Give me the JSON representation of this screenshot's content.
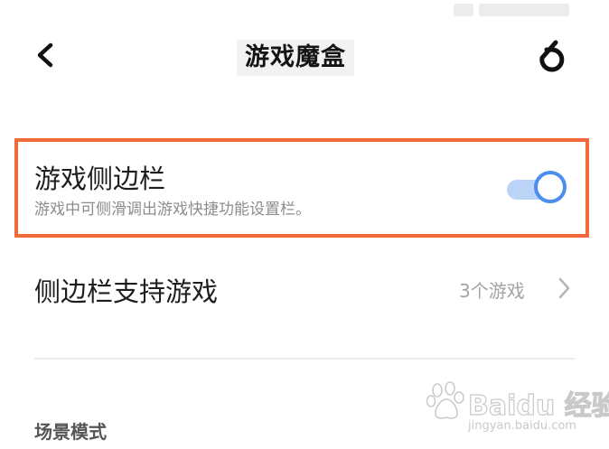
{
  "header": {
    "title": "游戏魔盒",
    "back_icon": "chevron-left-icon",
    "brand_icon": "brand-six-icon"
  },
  "game_sidebar": {
    "label": "游戏侧边栏",
    "description": "游戏中可侧滑调出游戏快捷功能设置栏。",
    "toggle_on": true,
    "highlight_color": "#f06a3c",
    "accent_color": "#4b8ef0"
  },
  "supported_games": {
    "label": "侧边栏支持游戏",
    "value": "3个游戏",
    "chevron_icon": "chevron-right-icon"
  },
  "scene_mode": {
    "section_title": "场景模式"
  },
  "watermark": {
    "text": "Baidu 经验",
    "url": "jingyan.baidu.com"
  }
}
